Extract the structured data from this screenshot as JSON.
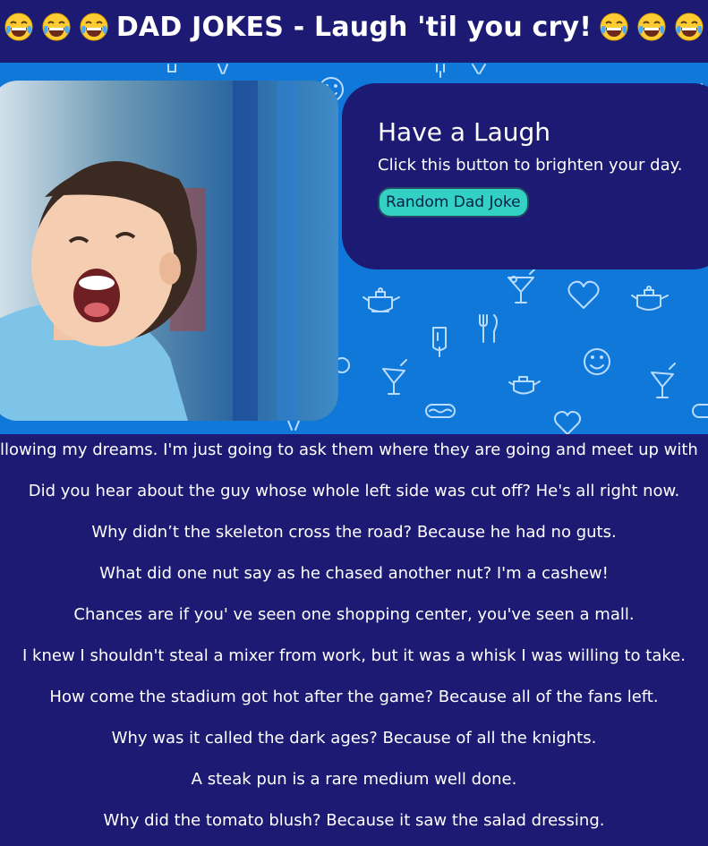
{
  "header": {
    "title": "DAD JOKES - Laugh 'til you cry!",
    "emoji_left_count": 3,
    "emoji_right_count": 3,
    "emoji_icon": "face-with-tears-of-joy-icon"
  },
  "hero": {
    "card": {
      "title": "Have a Laugh",
      "subtitle": "Click this button to brighten your day.",
      "button_label": "Random Dad Joke"
    },
    "photo": "laughing-boy-photo",
    "pattern_icons": [
      "popsicle-icon",
      "cocktail-icon",
      "heart-icon",
      "teapot-icon",
      "smiley-icon",
      "fork-knife-icon",
      "hotdog-icon"
    ]
  },
  "jokes": [
    "llowing my dreams. I'm just going to ask them where they are going and meet up with",
    "Did you hear about the guy whose whole left side was cut off? He's all right now.",
    "Why didn’t the skeleton cross the road? Because he had no guts.",
    "What did one nut say as he chased another nut? I'm a cashew!",
    "Chances are if you' ve seen one shopping center, you've seen a mall.",
    "I knew I shouldn't steal a mixer from work, but it was a whisk I was willing to take.",
    "How come the stadium got hot after the game? Because all of the fans left.",
    "Why was it called the dark ages? Because of all the knights.",
    "A steak pun is a rare medium well done.",
    "Why did the tomato blush? Because it saw the salad dressing."
  ],
  "colors": {
    "background": "#1c1a72",
    "hero": "#0f78d9",
    "button": "#33d1c4"
  }
}
